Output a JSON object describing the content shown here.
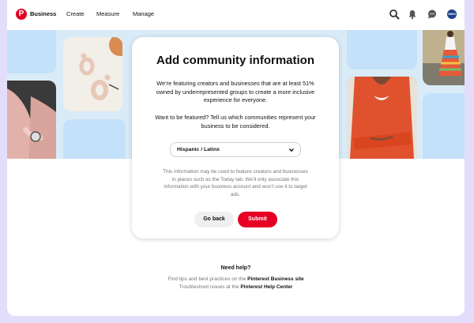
{
  "header": {
    "logo": "P",
    "brand": "Business",
    "nav": [
      "Create",
      "Measure",
      "Manage"
    ],
    "avatar": "MEM",
    "icons": [
      "search-icon",
      "bell-icon",
      "chat-icon"
    ]
  },
  "card": {
    "title": "Add community information",
    "intro": "We’re featuring creators and businesses that are at least 51% owned by underrepresented groups to create a more inclusive experience for everyone.",
    "prompt": "Want to be featured? Tell us which communities represent your business to be considered.",
    "select_value": "Hispanic / Latinx",
    "disclaimer": "This information may be used to feature creators and businesses in places such as the Today tab. We’ll only associate this information with your business account and won’t use it to target ads.",
    "back_label": "Go back",
    "submit_label": "Submit"
  },
  "help": {
    "title": "Need help?",
    "line1_prefix": "Find tips and best practices on the",
    "line1_link": "Pinterest Business site",
    "line2_prefix": "Troubleshoot issues at the",
    "line2_link": "Pinterest Help Center"
  },
  "colors": {
    "brand_red": "#e60023",
    "hero_bg": "#d8ebf7",
    "page_bg": "#e4dcfb"
  }
}
